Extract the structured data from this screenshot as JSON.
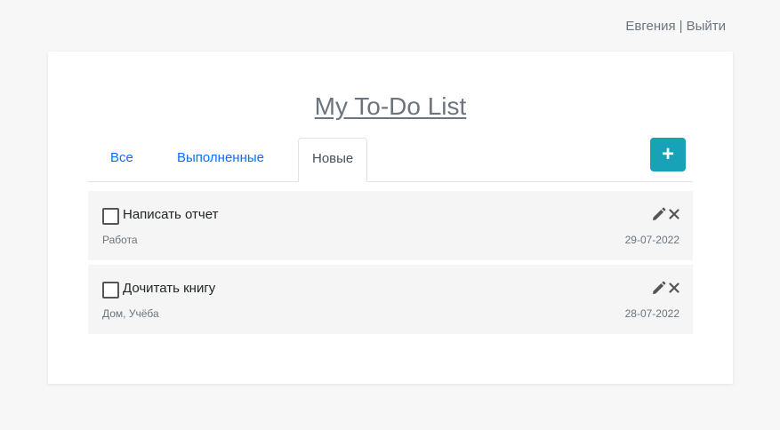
{
  "header": {
    "user_name": "Евгения",
    "separator": "|",
    "logout_label": "Выйти"
  },
  "main": {
    "title": "My To-Do List",
    "tabs": [
      {
        "label": "Все",
        "active": false
      },
      {
        "label": "Выполненные",
        "active": false
      },
      {
        "label": "Новые",
        "active": true
      }
    ],
    "add_button_label": "+",
    "tasks": [
      {
        "title": "Написать отчет",
        "tags": "Работа",
        "date": "29-07-2022",
        "done": false
      },
      {
        "title": "Дочитать книгу",
        "tags": "Дом, Учёба",
        "date": "28-07-2022",
        "done": false
      }
    ]
  },
  "colors": {
    "accent": "#17a2b8",
    "link": "#0d6efd",
    "item_background": "#f5f5f5",
    "page_background": "#f7f7f7"
  },
  "icons": {
    "add": "plus-icon",
    "edit": "pencil-icon",
    "delete": "close-icon"
  }
}
